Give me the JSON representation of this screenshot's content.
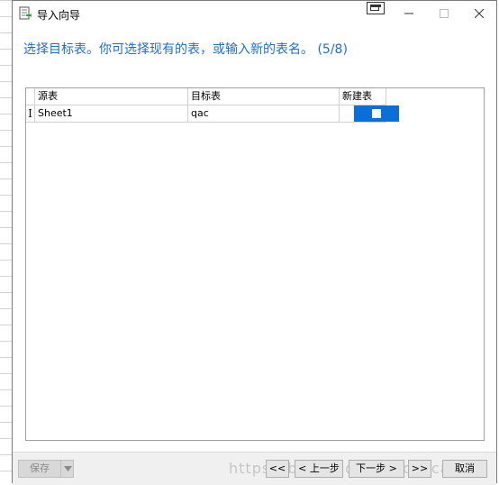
{
  "window": {
    "title": "导入向导"
  },
  "instruction": "选择目标表。你可选择现有的表，或输入新的表名。 (5/8)",
  "grid": {
    "columns": [
      "源表",
      "目标表",
      "新建表"
    ],
    "rows": [
      {
        "indicator": "I",
        "source": "Sheet1",
        "target": "qac",
        "new_table": false
      }
    ]
  },
  "footer": {
    "save_label": "保存",
    "first_label": "<<",
    "prev_label": "< 上一步",
    "next_label": "下一步 >",
    "last_label": ">>",
    "cancel_label": "取消",
    "watermark": "https://blog.csdn.net/qaccaa"
  },
  "colors": {
    "accent": "#1f6fc7",
    "selection": "#0a6fd6"
  }
}
